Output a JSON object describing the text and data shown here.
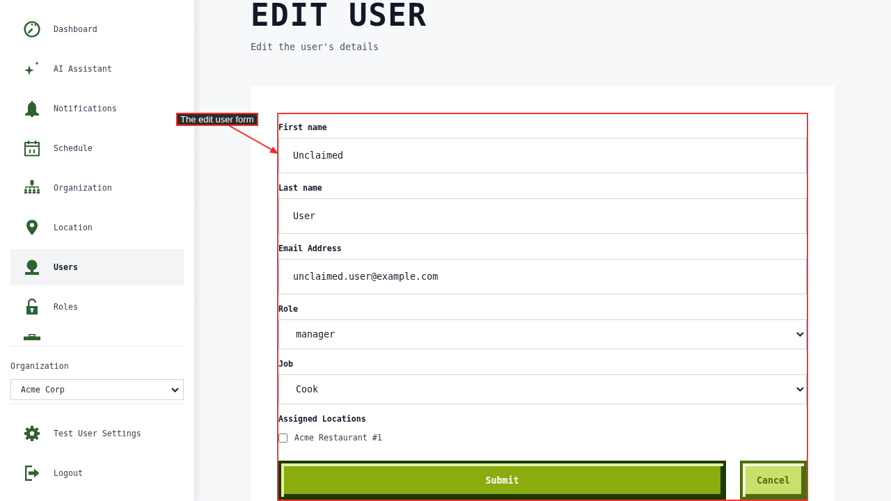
{
  "sidebar": {
    "nav_items": [
      {
        "label": "Dashboard",
        "selected": false
      },
      {
        "label": "AI Assistant",
        "selected": false
      },
      {
        "label": "Notifications",
        "selected": false
      },
      {
        "label": "Schedule",
        "selected": false
      },
      {
        "label": "Organization",
        "selected": false
      },
      {
        "label": "Location",
        "selected": false
      },
      {
        "label": "Users",
        "selected": true
      },
      {
        "label": "Roles",
        "selected": false
      }
    ],
    "organization_picker": {
      "label": "Organization",
      "value": "Acme Corp"
    },
    "footer_items": [
      {
        "label": "Test User Settings"
      },
      {
        "label": "Logout"
      }
    ]
  },
  "page": {
    "title": "EDIT USER",
    "subtitle": "Edit the user's details"
  },
  "form": {
    "fields": [
      {
        "kind": "text",
        "label": "First name",
        "value": "Unclaimed"
      },
      {
        "kind": "text",
        "label": "Last name",
        "value": "User"
      },
      {
        "kind": "text",
        "label": "Email Address",
        "value": "unclaimed.user@example.com"
      },
      {
        "kind": "select",
        "label": "Role",
        "value": "manager"
      },
      {
        "kind": "select",
        "label": "Job",
        "value": "Cook"
      },
      {
        "kind": "checklist",
        "label": "Assigned Locations",
        "options": [
          {
            "label": "Acme Restaurant #1",
            "checked": false
          }
        ]
      }
    ],
    "buttons": [
      {
        "kind": "primary",
        "label": "Submit"
      },
      {
        "kind": "secondary",
        "label": "Cancel"
      }
    ]
  },
  "annotation": {
    "label": "The edit user form"
  }
}
